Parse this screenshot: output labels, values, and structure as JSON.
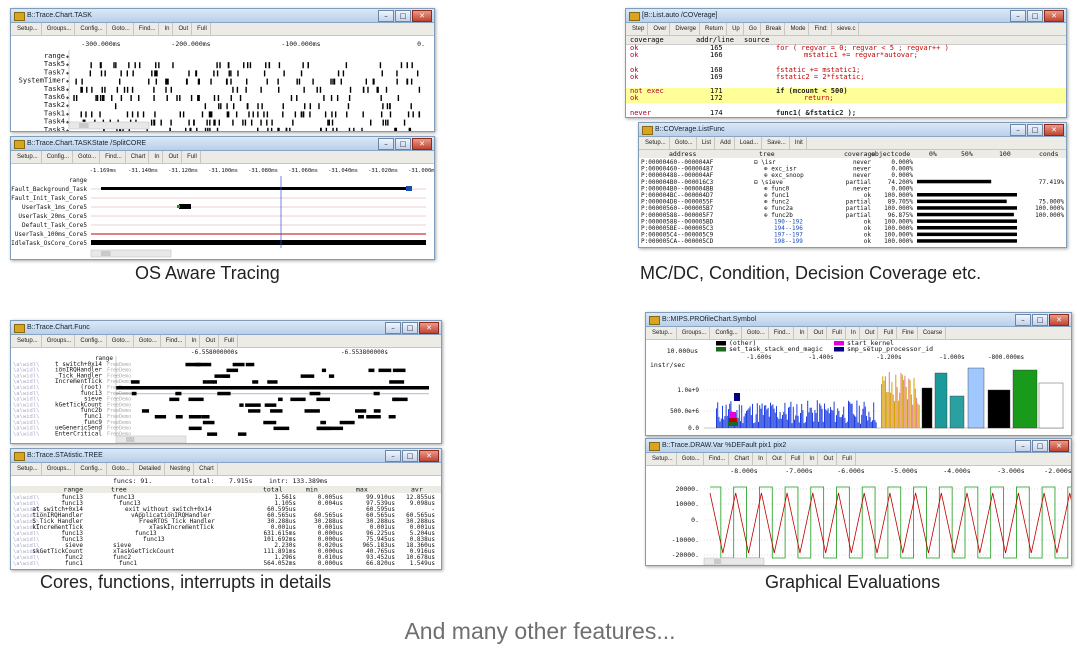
{
  "captions": {
    "os_aware": "OS Aware Tracing",
    "mcdc": "MC/DC, Condition, Decision Coverage etc.",
    "cores": "Cores, functions, interrupts in details",
    "graphical": "Graphical Evaluations",
    "footer": "And many other features..."
  },
  "colors": {
    "accent_yellow": "#ffff99",
    "trace_black": "#000000",
    "line_red": "#c00000",
    "fill_green": "#1a9a1a"
  },
  "win1": {
    "title": "B::Trace.Chart.TASK",
    "toolbar": [
      "Setup...",
      "Groups...",
      "Config...",
      "Goto...",
      "Find...",
      "In",
      "Out",
      "Full"
    ],
    "axis": [
      "-300.000ms",
      "-200.000ms",
      "-100.000ms",
      "0."
    ],
    "rows": [
      "range",
      "Task5",
      "Task7",
      "SystemTimer",
      "Task8",
      "Task6",
      "Task2",
      "Task1",
      "Task4",
      "Task3"
    ]
  },
  "win2": {
    "title": "B::Trace.Chart.TASKState /SplitCORE",
    "toolbar": [
      "Setup...",
      "Config...",
      "Goto...",
      "Find...",
      "Chart",
      "In",
      "Out",
      "Full"
    ],
    "axis": [
      "-1.169ms",
      "-31.140ms",
      "-31.120ms",
      "-31.100ms",
      "-31.080ms",
      "-31.060ms",
      "-31.040ms",
      "-31.020ms",
      "-31.000ms"
    ],
    "rows": [
      "range",
      "Fault_Background_Task",
      "Fault_Init_Task_Core5",
      "UserTask_1ms_Core5",
      "UserTask_20ms_Core5",
      "Default_Task_Core5",
      "UserTask_100ms_Core5",
      "IdleTask_OsCore_Core5"
    ]
  },
  "win3": {
    "title": "[B::List.auto /COVerage]",
    "toolbar": [
      "Step",
      "Over",
      "Diverge",
      "Return",
      "Up",
      "Go",
      "Break",
      "Mode",
      "Find:",
      "sieve.c"
    ],
    "headers": [
      "coverage",
      "addr/line",
      "source"
    ],
    "rows": [
      {
        "cov": "ok",
        "line": "165",
        "src": "for ( regvar = 0; regvar < 5 ; regvar++ )",
        "hl": false
      },
      {
        "cov": "ok",
        "line": "166",
        "src": "mstatic1 += regvar*autovar;",
        "hl": false
      },
      {
        "cov": "",
        "line": "",
        "src": "",
        "hl": false
      },
      {
        "cov": "ok",
        "line": "168",
        "src": "fstatic += mstatic1;",
        "hl": false
      },
      {
        "cov": "ok",
        "line": "169",
        "src": "fstatic2 = 2*fstatic;",
        "hl": false
      },
      {
        "cov": "",
        "line": "",
        "src": "",
        "hl": false
      },
      {
        "cov": "not exec",
        "line": "171",
        "src": "if (mcount < 500)",
        "hl": true
      },
      {
        "cov": "ok",
        "line": "172",
        "src": "return;",
        "hl": true
      },
      {
        "cov": "",
        "line": "",
        "src": "",
        "hl": false
      },
      {
        "cov": "never",
        "line": "174",
        "src": "func1( &fstatic2 );",
        "hl": false
      }
    ]
  },
  "win4": {
    "title": "B::COVerage.ListFunc",
    "toolbar": [
      "Setup...",
      "Goto...",
      "List",
      "Add",
      "Load...",
      "Save...",
      "Init"
    ],
    "headers": [
      "address",
      "tree",
      "coverage",
      "objectcode",
      "0%",
      "50%",
      "100",
      "conds"
    ],
    "rows": [
      {
        "addr": "P:00000460--000004AF",
        "tree": "\\isr",
        "cov": "never",
        "pct": "0.000%",
        "frac": 0.0,
        "conds": ""
      },
      {
        "addr": "P:00000460--00000487",
        "tree": "exc_isr",
        "cov": "never",
        "pct": "0.000%",
        "frac": 0.0,
        "conds": ""
      },
      {
        "addr": "P:00000488--000004AF",
        "tree": "exc_snoop",
        "cov": "never",
        "pct": "0.000%",
        "frac": 0.0,
        "conds": ""
      },
      {
        "addr": "P:000004B0--000016C3",
        "tree": "\\sieve",
        "cov": "partial",
        "pct": "74.200%",
        "frac": 0.742,
        "conds": "77.419%"
      },
      {
        "addr": "P:000004B0--000004BB",
        "tree": "func0",
        "cov": "never",
        "pct": "0.000%",
        "frac": 0.0,
        "conds": ""
      },
      {
        "addr": "P:000004BC--000004D7",
        "tree": "func1",
        "cov": "ok",
        "pct": "100.000%",
        "frac": 1.0,
        "conds": ""
      },
      {
        "addr": "P:000004D8--0000055F",
        "tree": "func2",
        "cov": "partial",
        "pct": "89.705%",
        "frac": 0.897,
        "conds": "75.000%"
      },
      {
        "addr": "P:00000560--000005B7",
        "tree": "func2a",
        "cov": "partial",
        "pct": "100.000%",
        "frac": 1.0,
        "conds": "100.000%"
      },
      {
        "addr": "P:00000588--000005F7",
        "tree": "func2b",
        "cov": "partial",
        "pct": "96.875%",
        "frac": 0.969,
        "conds": "100.000%"
      },
      {
        "addr": "P:00000588--000005BD",
        "tree": "190--192",
        "cov": "ok",
        "pct": "100.000%",
        "frac": 1.0,
        "conds": ""
      },
      {
        "addr": "P:000005BE--000005C3",
        "tree": "194--196",
        "cov": "ok",
        "pct": "100.000%",
        "frac": 1.0,
        "conds": ""
      },
      {
        "addr": "P:000005C4--000005C9",
        "tree": "197--197",
        "cov": "ok",
        "pct": "100.000%",
        "frac": 1.0,
        "conds": ""
      },
      {
        "addr": "P:000005CA--000005CD",
        "tree": "198--199",
        "cov": "ok",
        "pct": "100.000%",
        "frac": 1.0,
        "conds": ""
      }
    ]
  },
  "win5": {
    "title": "B::Trace.Chart.Func",
    "toolbar": [
      "Setup...",
      "Groups...",
      "Config...",
      "Goto...",
      "Goto...",
      "Find...",
      "In",
      "Out",
      "Full"
    ],
    "axis": [
      "-6.558000000s",
      "-6.553800000s"
    ],
    "rows": [
      "range",
      "t_switch+0x14",
      "ionIRQHandler",
      "_Tick_Handler",
      "IncrementTick",
      "(root)",
      "func13",
      "sieve",
      "kGetTickCount",
      "func2b",
      "func1",
      "func9",
      "ueGenericSend",
      "EnterCritical"
    ],
    "row_prefix": "\\a\\widl\\"
  },
  "win6": {
    "title": "B::Trace.STAtistic.TREE",
    "toolbar": [
      "Setup...",
      "Groups...",
      "Config...",
      "Goto...",
      "Detailed",
      "Nesting",
      "Chart"
    ],
    "summary": [
      "funcs: 91.",
      "total:",
      "7.915s",
      "intr: 133.389ms"
    ],
    "headers": [
      "range",
      "tree",
      "total",
      "min",
      "max",
      "avr"
    ],
    "rows": [
      {
        "range": "func13",
        "tree": "func13",
        "total": "1.561s",
        "min": "0.005us",
        "max": "99.910us",
        "avr": "12.855us"
      },
      {
        "range": "func13",
        "tree": "func13",
        "total": "1.105s",
        "min": "0.004us",
        "max": "97.539us",
        "avr": "9.098us"
      },
      {
        "range": "at_switch+0x14",
        "tree": "exit_without_switch+0x14",
        "total": "60.595us",
        "min": "-",
        "max": "60.595us",
        "avr": "-"
      },
      {
        "range": "tionIRQHandler",
        "tree": "vApplicationIRQHandler",
        "total": "60.565us",
        "min": "60.565us",
        "max": "60.565us",
        "avr": "60.565us"
      },
      {
        "range": "S_Tick_Handler",
        "tree": "FreeRTOS_Tick_Handler",
        "total": "30.288us",
        "min": "30.288us",
        "max": "30.288us",
        "avr": "30.288us"
      },
      {
        "range": "kIncrementTick",
        "tree": "xTaskIncrementTick",
        "total": "0.001us",
        "min": "0.001us",
        "max": "0.001us",
        "avr": "0.001us"
      },
      {
        "range": "func13",
        "tree": "func13",
        "total": "631.615ms",
        "min": "0.000us",
        "max": "96.225us",
        "avr": "5.204us"
      },
      {
        "range": "func13",
        "tree": "func13",
        "total": "101.692ms",
        "min": "0.000us",
        "max": "75.945us",
        "avr": "0.838us"
      },
      {
        "range": "sieve",
        "tree": "sieve",
        "total": "2.230s",
        "min": "0.020us",
        "max": "965.183us",
        "avr": "18.360us"
      },
      {
        "range": "skGetTickCount",
        "tree": "xTaskGetTickCount",
        "total": "111.891ms",
        "min": "0.000us",
        "max": "40.765us",
        "avr": "0.916us"
      },
      {
        "range": "func2",
        "tree": "func2",
        "total": "1.296s",
        "min": "0.010us",
        "max": "93.452us",
        "avr": "10.678us"
      },
      {
        "range": "func1",
        "tree": "func1",
        "total": "564.052ms",
        "min": "0.000us",
        "max": "66.820us",
        "avr": "1.549us"
      }
    ]
  },
  "win7": {
    "title": "B::MIPS.PROfileChart.Symbol",
    "toolbar": [
      "Setup...",
      "Groups...",
      "Config...",
      "Goto...",
      "Find...",
      "In",
      "Out",
      "Full",
      "In",
      "Out",
      "Full",
      "Fine",
      "Coarse"
    ],
    "legend": [
      {
        "name": "(other)",
        "color": "#000000"
      },
      {
        "name": "start_kernel",
        "color": "#e000e0"
      },
      {
        "name": "set_task_stack_end_magic",
        "color": "#1a6a1a"
      },
      {
        "name": "smp_setup_processor_id",
        "color": "#000080"
      }
    ],
    "header_time": "10.000us",
    "axis": [
      "-1.600s",
      "-1.400s",
      "-1.200s",
      "-1.000s",
      "-800.000ms"
    ],
    "ylabel": "instr/sec",
    "yticks": [
      "1.0e+9",
      "500.0e+6",
      "0.0"
    ]
  },
  "win8": {
    "title": "B::Trace.DRAW.Var %DEFault pix1 pix2",
    "toolbar": [
      "Setup...",
      "Goto...",
      "Find...",
      "Chart",
      "In",
      "Out",
      "Full",
      "In",
      "Out",
      "Full"
    ],
    "axis": [
      "-8.000s",
      "-7.000s",
      "-6.000s",
      "-5.000s",
      "-4.000s",
      "-3.000s",
      "-2.000s"
    ],
    "yticks": [
      "20000.",
      "10000.",
      "0.",
      "-10000.",
      "-20000."
    ]
  }
}
